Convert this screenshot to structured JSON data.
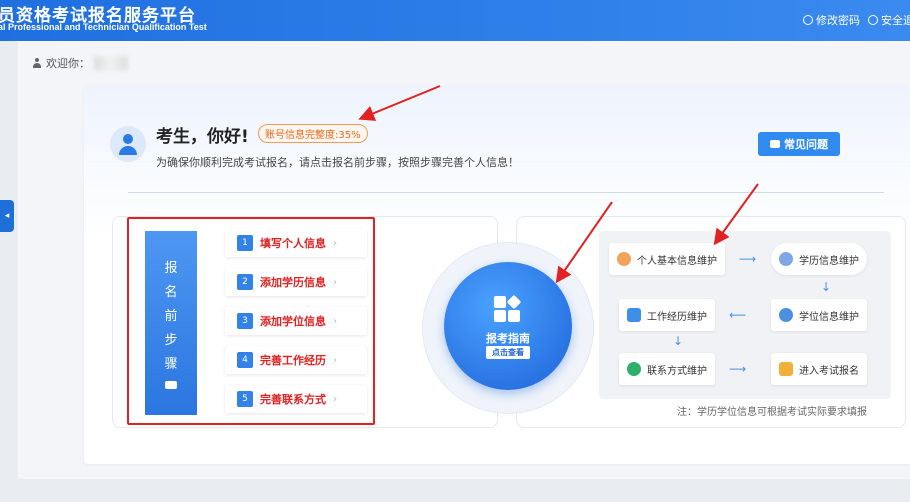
{
  "header": {
    "title": "员资格考试报名服务平台",
    "subtitle": "al Professional and Technician Qualification Test",
    "change_password": "修改密码",
    "logout": "安全退"
  },
  "welcome": {
    "label": "欢迎你："
  },
  "side_tab": {
    "arrow": "◂"
  },
  "greeting": {
    "text": "考生，你好!",
    "completeness_badge": "账号信息完整度:35%",
    "tip": "为确保你顺利完成考试报名，请点击报名前步骤，按照步骤完善个人信息！"
  },
  "faq_button": {
    "label": "常见问题"
  },
  "steps": {
    "vertical_title": [
      "报",
      "名",
      "前",
      "步",
      "骤"
    ],
    "items": [
      {
        "num": "1",
        "label": "填写个人信息"
      },
      {
        "num": "2",
        "label": "添加学历信息"
      },
      {
        "num": "3",
        "label": "添加学位信息"
      },
      {
        "num": "4",
        "label": "完善工作经历"
      },
      {
        "num": "5",
        "label": "完善联系方式"
      }
    ],
    "arrow_glyph": "›"
  },
  "guide": {
    "title": "报考指南",
    "button": "点击查看"
  },
  "flow": {
    "nodes": {
      "basic": "个人基本信息维护",
      "education": "学历信息维护",
      "work": "工作经历维护",
      "degree": "学位信息维护",
      "contact": "联系方式维护",
      "enroll": "进入考试报名"
    },
    "note": "注：学历学位信息可根据考试实际要求填报"
  },
  "colors": {
    "primary": "#2f8bf0",
    "highlight_red": "#e02222",
    "badge_orange": "#e8691c"
  }
}
